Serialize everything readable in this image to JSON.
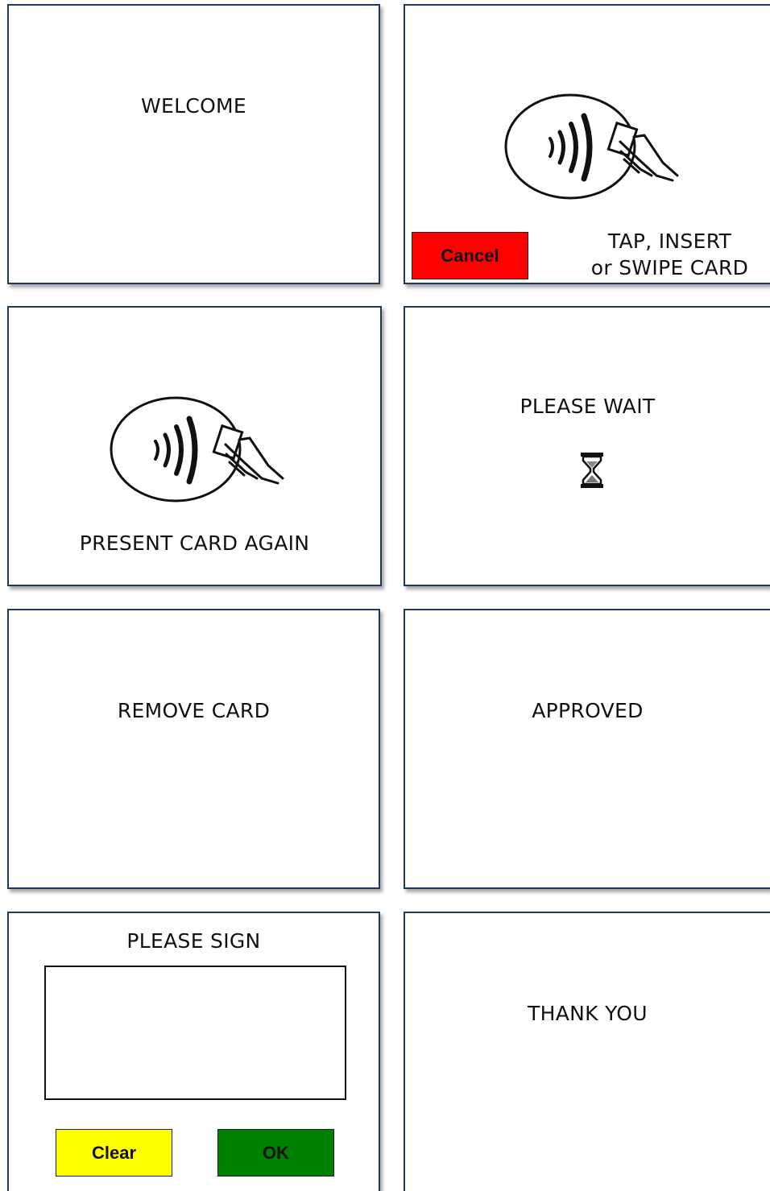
{
  "screens": {
    "welcome": {
      "title": "WELCOME"
    },
    "tap": {
      "line1": "TAP, INSERT",
      "line2": "or SWIPE CARD",
      "cancel_label": "Cancel",
      "icon": "contactless-tap-icon"
    },
    "present_again": {
      "title": "PRESENT CARD AGAIN",
      "icon": "contactless-tap-icon"
    },
    "please_wait": {
      "title": "PLEASE WAIT",
      "icon": "hourglass-icon"
    },
    "remove_card": {
      "title": "REMOVE CARD"
    },
    "approved": {
      "title": "APPROVED"
    },
    "please_sign": {
      "title": "PLEASE SIGN",
      "clear_label": "Clear",
      "ok_label": "OK"
    },
    "thank_you": {
      "title": "THANK YOU"
    }
  },
  "colors": {
    "frame_border": "#1f3a5f",
    "cancel_button": "#ff0000",
    "clear_button": "#ffff00",
    "ok_button": "#008000"
  }
}
